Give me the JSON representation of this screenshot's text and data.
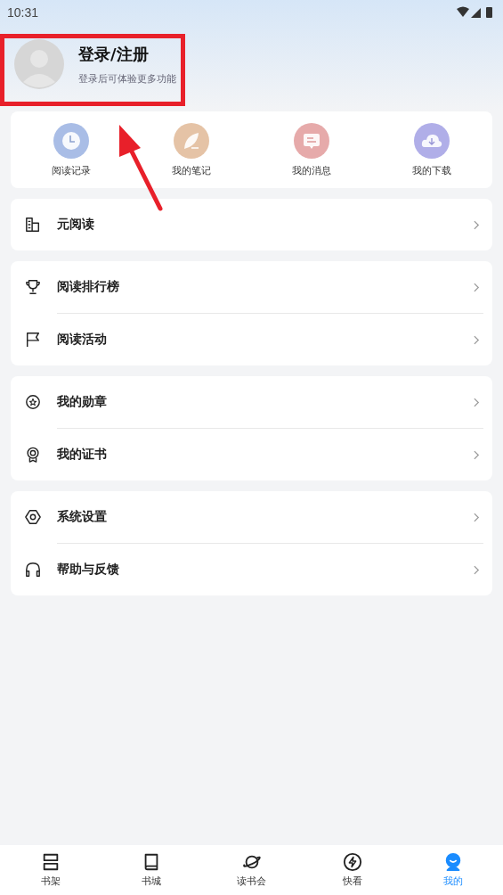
{
  "status_bar": {
    "time": "10:31"
  },
  "profile": {
    "title": "登录/注册",
    "subtitle": "登录后可体验更多功能"
  },
  "shortcuts": [
    {
      "label": "阅读记录",
      "color": "#a9bde6"
    },
    {
      "label": "我的笔记",
      "color": "#e5c3a6"
    },
    {
      "label": "我的消息",
      "color": "#e6aaaa"
    },
    {
      "label": "我的下载",
      "color": "#b0aee8"
    }
  ],
  "menu_groups": [
    [
      {
        "label": "元阅读"
      }
    ],
    [
      {
        "label": "阅读排行榜"
      },
      {
        "label": "阅读活动"
      }
    ],
    [
      {
        "label": "我的勋章"
      },
      {
        "label": "我的证书"
      }
    ],
    [
      {
        "label": "系统设置"
      },
      {
        "label": "帮助与反馈"
      }
    ]
  ],
  "tab_bar": [
    {
      "label": "书架",
      "selected": false
    },
    {
      "label": "书城",
      "selected": false
    },
    {
      "label": "读书会",
      "selected": false
    },
    {
      "label": "快看",
      "selected": false
    },
    {
      "label": "我的",
      "selected": true
    }
  ]
}
